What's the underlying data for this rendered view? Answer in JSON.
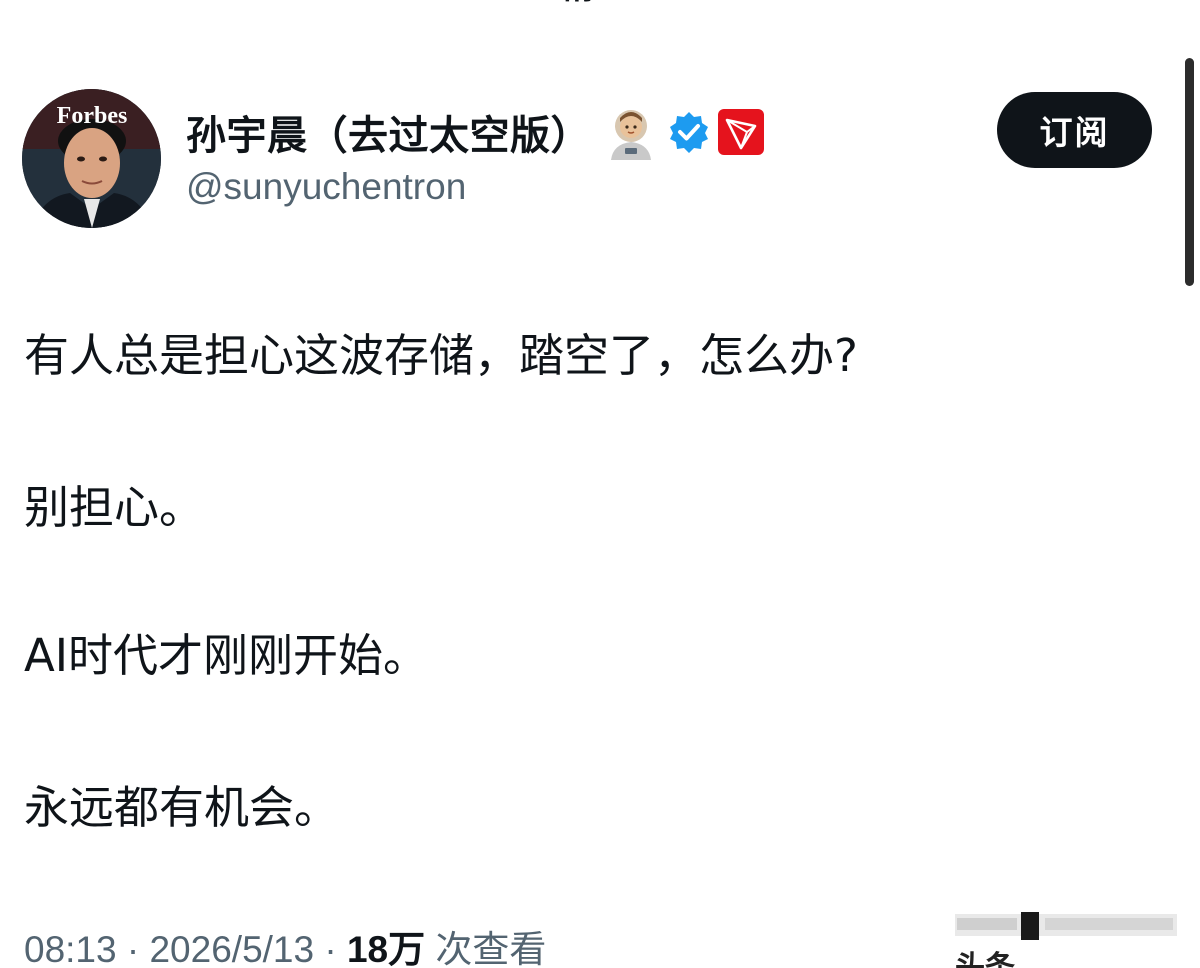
{
  "top_fragment": "精",
  "author": {
    "display_name": "孙宇晨（去过太空版）",
    "handle": "@sunyuchentron",
    "avatar_text": "Forbes",
    "badges": [
      "astronaut-emoji",
      "verified-badge-icon",
      "tron-logo-icon"
    ]
  },
  "subscribe_label": "订阅",
  "tweet": {
    "lines": [
      "有人总是担心这波存储，踏空了，怎么办?",
      "别担心。",
      "AI时代才刚刚开始。",
      "永远都有机会。"
    ]
  },
  "meta": {
    "time": "08:13",
    "separator": " · ",
    "date": "2026/5/13",
    "views_count": "18万",
    "views_label": " 次查看"
  },
  "watermark": "头条",
  "colors": {
    "text_primary": "#0f1419",
    "text_secondary": "#536471",
    "verified_blue": "#1d9bf0",
    "tron_red": "#e5131d",
    "button_bg": "#0f1419"
  }
}
